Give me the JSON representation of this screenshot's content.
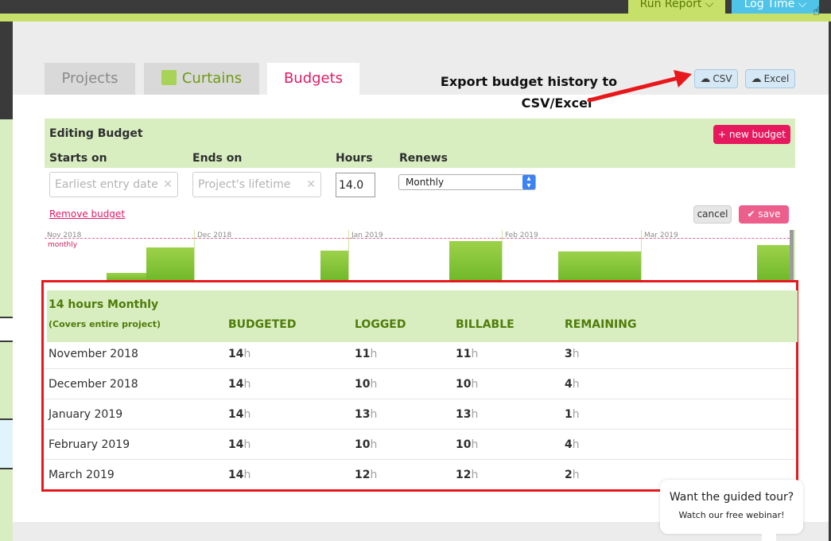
{
  "topbar": {
    "run_report": "Run Report ⌵",
    "log_time": "Log Time ⌵"
  },
  "tabs": [
    {
      "label": "Projects"
    },
    {
      "label": "Curtains",
      "swatch": "#a7d456"
    },
    {
      "label": "Budgets",
      "active": true
    }
  ],
  "annotation": {
    "line1": "Export budget history to",
    "line2": "CSV/Excel"
  },
  "export": {
    "csv": "CSV",
    "excel": "Excel"
  },
  "editor": {
    "title": "Editing Budget",
    "new_budget": "+ new budget",
    "starts_on_label": "Starts on",
    "ends_on_label": "Ends on",
    "hours_label": "Hours",
    "renews_label": "Renews",
    "starts_on_placeholder": "Earliest entry date",
    "ends_on_placeholder": "Project's lifetime",
    "hours_value": "14.0",
    "renews_value": "Monthly",
    "remove": "Remove budget",
    "cancel": "cancel",
    "save": "save"
  },
  "mini_chart": {
    "months": [
      "Nov 2018",
      "Dec 2018",
      "Jan 2019",
      "Feb 2019",
      "Mar 2019"
    ],
    "series_label": "monthly"
  },
  "budget_table": {
    "title": "14 hours Monthly",
    "subtitle": "(Covers entire project)",
    "unit": "h",
    "columns": [
      "BUDGETED",
      "LOGGED",
      "BILLABLE",
      "REMAINING"
    ],
    "rows": [
      {
        "month": "November 2018",
        "budgeted": "14",
        "logged": "11",
        "billable": "11",
        "remaining": "3"
      },
      {
        "month": "December 2018",
        "budgeted": "14",
        "logged": "10",
        "billable": "10",
        "remaining": "4"
      },
      {
        "month": "January 2019",
        "budgeted": "14",
        "logged": "13",
        "billable": "13",
        "remaining": "1"
      },
      {
        "month": "February 2019",
        "budgeted": "14",
        "logged": "10",
        "billable": "10",
        "remaining": "4"
      },
      {
        "month": "March 2019",
        "budgeted": "14",
        "logged": "12",
        "billable": "12",
        "remaining": "2"
      }
    ]
  },
  "tour": {
    "title": "Want the guided tour?",
    "subtitle": "Watch our free webinar!"
  },
  "colors": {
    "brand_green": "#c7e06a",
    "accent_pink": "#e01a64",
    "table_green_text": "#4f7c0a",
    "highlight_red": "#e8171b"
  }
}
